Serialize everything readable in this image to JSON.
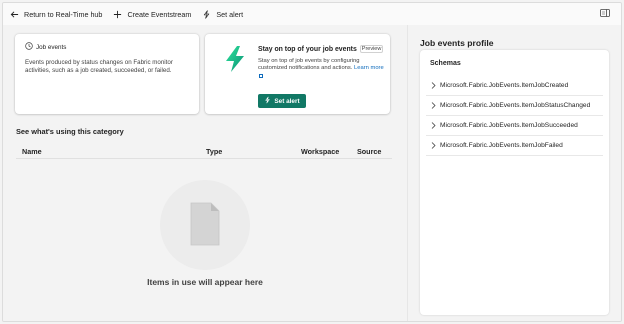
{
  "toolbar": {
    "return_label": "Return to Real-Time hub",
    "create_label": "Create Eventstream",
    "set_alert_label": "Set alert"
  },
  "info_card": {
    "title": "Job events",
    "description": "Events produced by status changes on Fabric monitor activities, such as a job created, succeeded, or failed."
  },
  "alert_card": {
    "title": "Stay on top of your job events",
    "badge": "Preview",
    "description": "Stay on top of job events by configuring customized notifications and actions.",
    "learn_more": "Learn more",
    "button_label": "Set alert",
    "accent_color": "#117865"
  },
  "usage": {
    "section_title": "See what's using this category",
    "columns": [
      "Name",
      "Type",
      "Workspace",
      "Source"
    ],
    "empty_text": "Items in use will appear here"
  },
  "profile": {
    "title": "Job events profile",
    "schemas_title": "Schemas",
    "schemas": [
      "Microsoft.Fabric.JobEvents.ItemJobCreated",
      "Microsoft.Fabric.JobEvents.ItemJobStatusChanged",
      "Microsoft.Fabric.JobEvents.ItemJobSucceeded",
      "Microsoft.Fabric.JobEvents.ItemJobFailed"
    ]
  }
}
